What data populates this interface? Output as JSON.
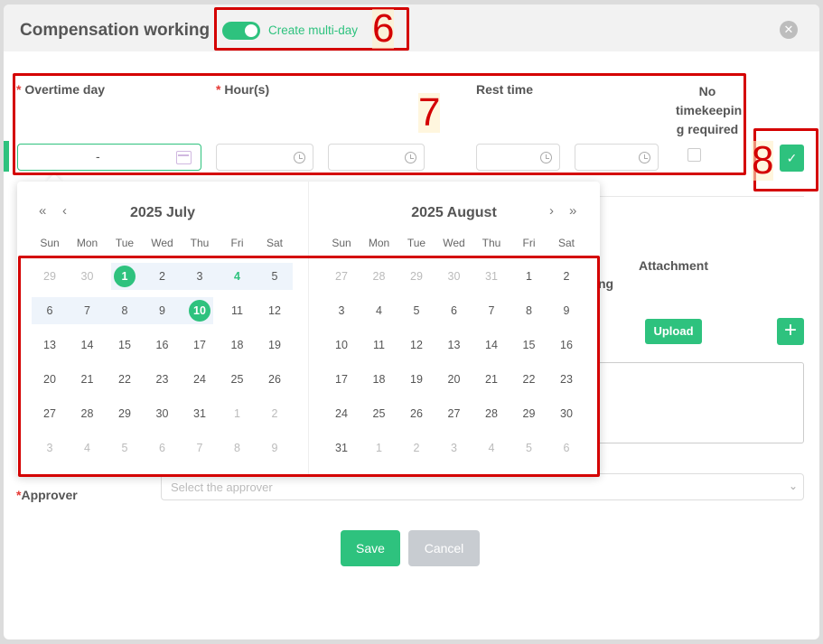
{
  "modal": {
    "title": "Compensation working",
    "toggle_label": "Create multi-day",
    "close_glyph": "✕"
  },
  "annotations": [
    "6",
    "7",
    "8"
  ],
  "fields": {
    "overtime_day": "Overtime day",
    "hours": "Hour(s)",
    "rest_time": "Rest time",
    "no_timekeeping_line1": "No",
    "no_timekeeping_line2": "timekeepin",
    "no_timekeeping_line3": "g required",
    "date_separator": "-",
    "required_mark": "*"
  },
  "confirm_glyph": "✓",
  "attachment_label": "Attachment",
  "ng_fragment": "ng",
  "upload_label": "Upload",
  "plus_glyph": "+",
  "approver": {
    "label": "Approver",
    "placeholder": "Select the approver"
  },
  "buttons": {
    "save": "Save",
    "cancel": "Cancel"
  },
  "calendar": {
    "weekdays": [
      "Sun",
      "Mon",
      "Tue",
      "Wed",
      "Thu",
      "Fri",
      "Sat"
    ],
    "nav_prev_year": "«",
    "nav_prev_month": "‹",
    "nav_next_month": "›",
    "nav_next_year": "»",
    "left": {
      "title": "2025 July",
      "days": [
        [
          "29",
          "30",
          "1",
          "2",
          "3",
          "4",
          "5"
        ],
        [
          "6",
          "7",
          "8",
          "9",
          "10",
          "11",
          "12"
        ],
        [
          "13",
          "14",
          "15",
          "16",
          "17",
          "18",
          "19"
        ],
        [
          "20",
          "21",
          "22",
          "23",
          "24",
          "25",
          "26"
        ],
        [
          "27",
          "28",
          "29",
          "30",
          "31",
          "1",
          "2"
        ],
        [
          "3",
          "4",
          "5",
          "6",
          "7",
          "8",
          "9"
        ]
      ]
    },
    "right": {
      "title": "2025 August",
      "days": [
        [
          "27",
          "28",
          "29",
          "30",
          "31",
          "1",
          "2"
        ],
        [
          "3",
          "4",
          "5",
          "6",
          "7",
          "8",
          "9"
        ],
        [
          "10",
          "11",
          "12",
          "13",
          "14",
          "15",
          "16"
        ],
        [
          "17",
          "18",
          "19",
          "20",
          "21",
          "22",
          "23"
        ],
        [
          "24",
          "25",
          "26",
          "27",
          "28",
          "29",
          "30"
        ],
        [
          "31",
          "1",
          "2",
          "3",
          "4",
          "5",
          "6"
        ]
      ]
    },
    "selected_start": "1",
    "selected_end": "10",
    "today": "4"
  },
  "colors": {
    "accent": "#2ec27e",
    "annotation": "#d40000"
  }
}
